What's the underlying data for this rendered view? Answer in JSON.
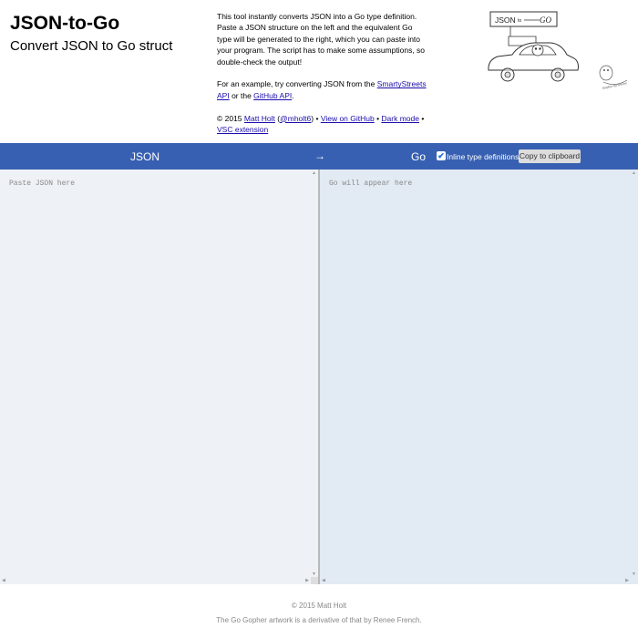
{
  "header": {
    "title": "JSON-to-Go",
    "subtitle": "Convert JSON to Go struct"
  },
  "description": {
    "para1": "This tool instantly converts JSON into a Go type definition. Paste a JSON structure on the left and the equivalent Go type will be generated to the right, which you can paste into your program. The script has to make some assumptions, so double-check the output!",
    "para2_prefix": "For an example, try converting JSON from the ",
    "link_smartystreets": "SmartyStreets API",
    "para2_middle": " or the ",
    "link_github_api": "GitHub API",
    "para2_suffix": ".",
    "copy_prefix": "© 2015 ",
    "link_author": "Matt Holt",
    "handle_open": " (",
    "link_handle": "@mholt6",
    "handle_close": ") • ",
    "link_view_github": "View on GitHub",
    "sep1": " • ",
    "link_dark_mode": "Dark mode",
    "sep2": " • ",
    "link_vsc": "VSC extension"
  },
  "illustration": {
    "sign_json": "JSON",
    "sign_to": "to",
    "sign_go": "GO",
    "caption": "Gopher by Renee"
  },
  "bar": {
    "json_label": "JSON",
    "arrow": "→",
    "go_label": "Go",
    "inline_label": "Inline type definitions",
    "inline_checked": true,
    "copy_label": "Copy to clipboard"
  },
  "editor": {
    "input_placeholder": "Paste JSON here",
    "output_placeholder": "Go will appear here"
  },
  "footer": {
    "copyright": "© 2015 Matt Holt",
    "credit": "The Go Gopher artwork is a derivative of that by Renee French."
  },
  "colors": {
    "bar": "#3860b2",
    "left_pane": "#eef1f5",
    "right_pane": "#e2eaf3",
    "link": "#1a0dab"
  }
}
